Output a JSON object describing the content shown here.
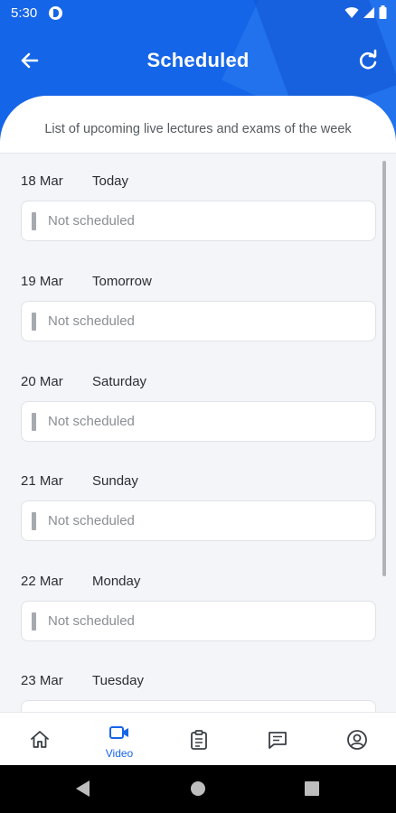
{
  "status_bar": {
    "time": "5:30"
  },
  "app_bar": {
    "title": "Scheduled"
  },
  "subtitle": "List of upcoming live lectures and exams of the week",
  "days": [
    {
      "date": "18 Mar",
      "day": "Today",
      "status": "Not scheduled"
    },
    {
      "date": "19 Mar",
      "day": "Tomorrow",
      "status": "Not scheduled"
    },
    {
      "date": "20 Mar",
      "day": "Saturday",
      "status": "Not scheduled"
    },
    {
      "date": "21 Mar",
      "day": "Sunday",
      "status": "Not scheduled"
    },
    {
      "date": "22 Mar",
      "day": "Monday",
      "status": "Not scheduled"
    },
    {
      "date": "23 Mar",
      "day": "Tuesday",
      "status": ""
    }
  ],
  "bottom_nav": {
    "items": [
      {
        "icon": "home-icon",
        "label": ""
      },
      {
        "icon": "video-icon",
        "label": "Video",
        "active": true
      },
      {
        "icon": "clipboard-icon",
        "label": ""
      },
      {
        "icon": "chat-icon",
        "label": ""
      },
      {
        "icon": "profile-icon",
        "label": ""
      }
    ]
  },
  "colors": {
    "primary": "#1565e8",
    "background": "#f3f5f8",
    "muted_text": "#8a8e93"
  }
}
